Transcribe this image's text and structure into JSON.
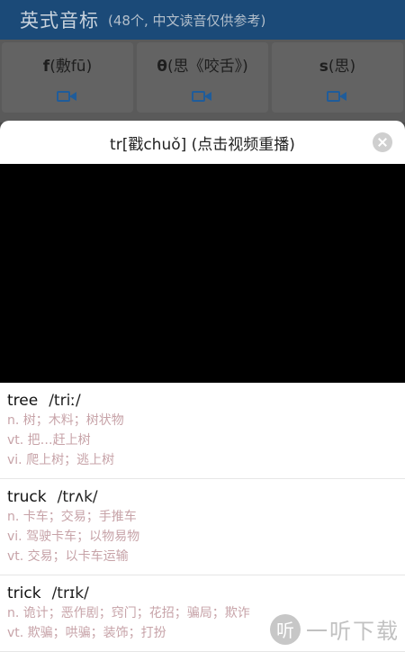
{
  "background": {
    "title": "英式音标",
    "subtitle": "(48个, 中文读音仅供参考)",
    "cells": [
      {
        "symbol": "f",
        "hint": "(敷fū)"
      },
      {
        "symbol": "θ",
        "hint": "(思《咬舌》)"
      },
      {
        "symbol": "s",
        "hint": "(思)"
      }
    ]
  },
  "sheet": {
    "title": "tr[戳chuǒ] (点击视频重播)"
  },
  "entries": [
    {
      "word": "tree",
      "ipa": "/triː/",
      "defs": [
        "n. 树；木料；树状物",
        "vt. 把…赶上树",
        "vi. 爬上树；逃上树"
      ]
    },
    {
      "word": "truck",
      "ipa": "/trʌk/",
      "defs": [
        "n. 卡车；交易；手推车",
        "vi. 驾驶卡车；以物易物",
        "vt. 交易；以卡车运输"
      ]
    },
    {
      "word": "trick",
      "ipa": "/trɪk/",
      "defs": [
        "n. 诡计；恶作剧；窍门；花招；骗局；欺诈",
        "vt. 欺骗；哄骗；装饰；打扮"
      ]
    }
  ],
  "watermark": {
    "logo": "听",
    "text": "一听下载"
  },
  "colors": {
    "header": "#1b4a78",
    "accent": "#1f5c9a",
    "definition": "#c7a3a8"
  }
}
